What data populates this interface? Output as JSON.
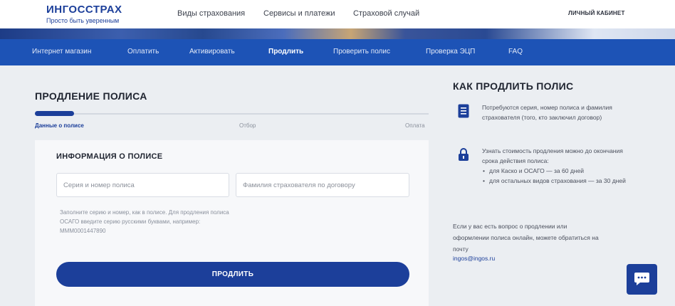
{
  "header": {
    "logo_name": "ИНГОССТРАХ",
    "logo_tagline": "Просто быть уверенным",
    "nav": [
      "Виды страхования",
      "Сервисы и платежи",
      "Страховой случай"
    ],
    "cabinet": "ЛИЧНЫЙ КАБИНЕТ"
  },
  "subnav": {
    "items": [
      "Интернет магазин",
      "Оплатить",
      "Активировать",
      "Продлить",
      "Проверить полис",
      "Проверка ЭЦП",
      "FAQ"
    ],
    "active": "Продлить"
  },
  "main": {
    "title": "ПРОДЛЕНИЕ ПОЛИСА",
    "progress_fraction": 0.1,
    "steps": [
      "Данные о полисе",
      "Отбор",
      "Оплата"
    ],
    "card_title": "ИНФОРМАЦИЯ О ПОЛИСЕ",
    "policy_field": {
      "placeholder": "Серия и номер полиса",
      "value": ""
    },
    "insurer_field": {
      "placeholder": "Фамилия страхователя по договору",
      "value": ""
    },
    "hint": "Заполните серию и номер, как в полисе. Для продления полиса ОСАГО введите серию русскими буквами, например: МММ0001447890",
    "submit_label": "ПРОДЛИТЬ"
  },
  "sidebar": {
    "title": "КАК ПРОДЛИТЬ ПОЛИС",
    "tip1": "Потребуются серия, номер полиса и фамилия страхователя (того, кто заключил договор)",
    "tip2_text": "Узнать стоимость продления можно до окончания срока действия полиса:",
    "tip2_items": [
      "для Каско и ОСАГО — за 60 дней",
      "для остальных видов страхования — за 30 дней"
    ],
    "help_text": "Если у вас есть вопрос о продлении или оформлении полиса онлайн, можете обратиться на почту",
    "help_email": "ingos@ingos.ru"
  },
  "icons": {
    "tip1": "document-icon",
    "tip2": "lock-icon",
    "chat": "chat-icon"
  },
  "colors": {
    "brand": "#1c3f9a",
    "nav_bar": "#1d53b6",
    "background": "#ebeef2"
  }
}
